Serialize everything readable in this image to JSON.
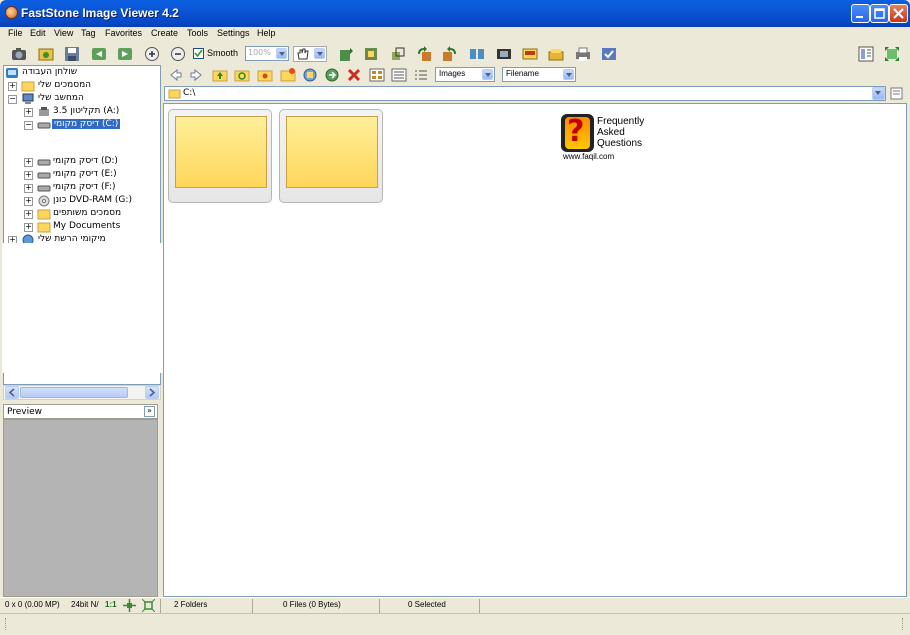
{
  "window": {
    "title": "FastStone Image Viewer 4.2"
  },
  "menu": {
    "items": [
      "File",
      "Edit",
      "View",
      "Tag",
      "Favorites",
      "Create",
      "Tools",
      "Settings",
      "Help"
    ]
  },
  "toolbar": {
    "smooth_label": "Smooth",
    "smooth_checked": true,
    "zoom_value": "100%"
  },
  "tree": {
    "items": [
      {
        "label": "שולחן העבודה"
      },
      {
        "label": "המסמכים שלי"
      },
      {
        "label": "המחשב שלי"
      },
      {
        "label": "תקליטון 3.5 (A:)"
      },
      {
        "label": "דיסק מקומי (C:)"
      },
      {
        "label": "דיסק מקומי (D:)"
      },
      {
        "label": "דיסק מקומי (E:)"
      },
      {
        "label": "דיסק מקומי (F:)"
      },
      {
        "label": "כונן DVD-RAM (G:)"
      },
      {
        "label": "מסמכים משותפים"
      },
      {
        "label": "My Documents"
      },
      {
        "label": "מיקומי הרשת שלי"
      }
    ]
  },
  "preview": {
    "title": "Preview"
  },
  "browser": {
    "filter_value": "Images",
    "sort_value": "Filename",
    "path": "C:\\",
    "folder_count": 2
  },
  "faq_logo": {
    "line1": "Frequently",
    "line2": "Asked",
    "line3": "Questions",
    "url": "www.faqil.com"
  },
  "status": {
    "image_info": "0 x 0 (0.00 MP)",
    "color_depth": "24bit N/",
    "ratio": "1:1",
    "folders": "2 Folders",
    "files": "0 Files (0 Bytes)",
    "selected": "0 Selected"
  },
  "colors": {
    "titlebar": "#0a55d4",
    "selection": "#316ac5",
    "folder": "#ffd65a",
    "preview_bg": "#b4b4b4"
  }
}
